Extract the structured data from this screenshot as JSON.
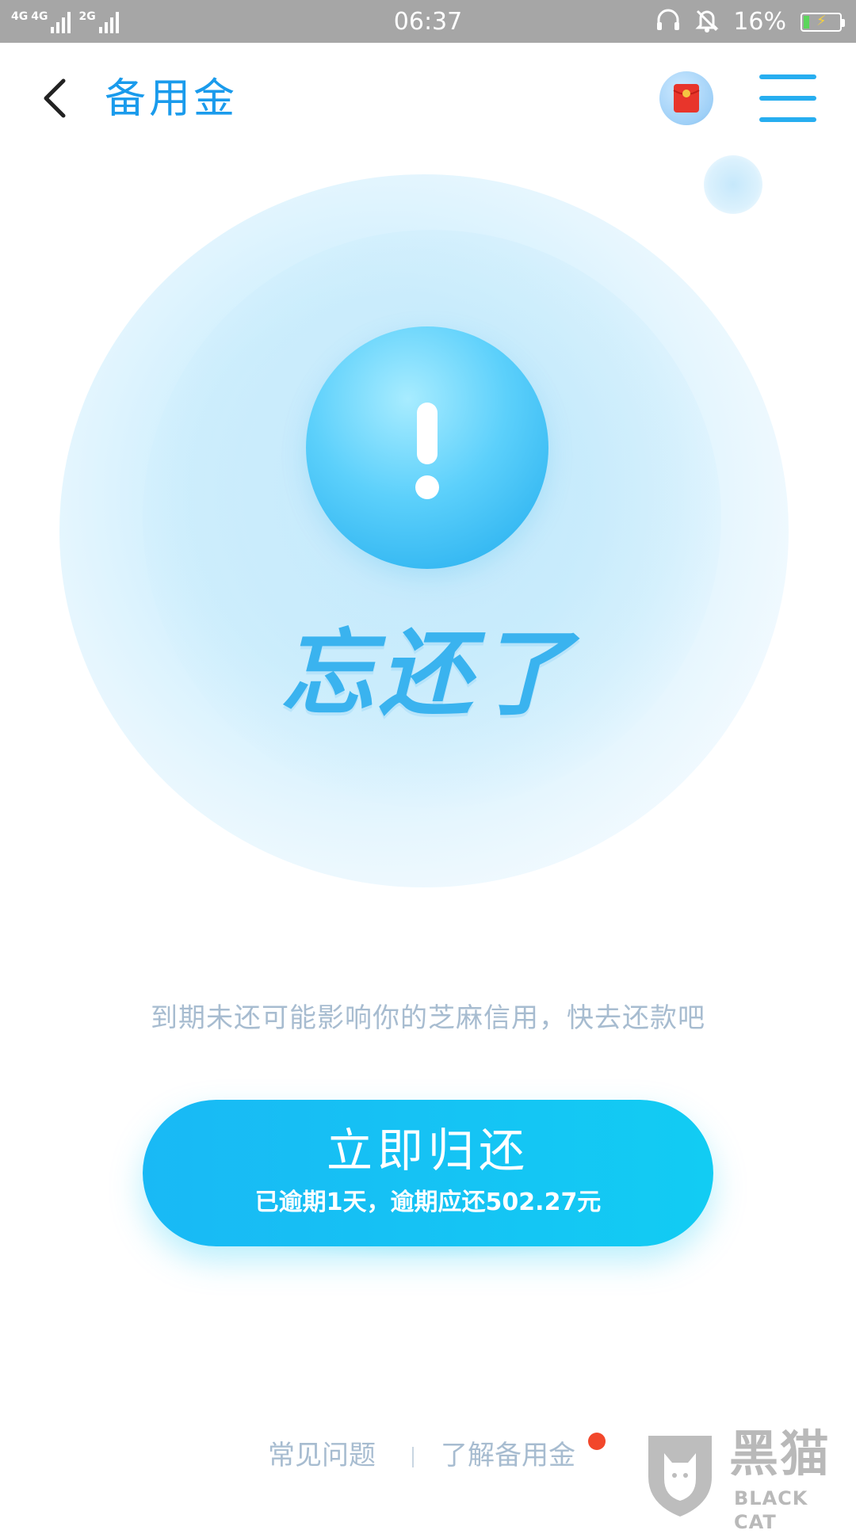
{
  "status_bar": {
    "network_1": "4G",
    "network_2": "4G",
    "network_3": "2G",
    "time": "06:37",
    "battery_percent": "16%",
    "battery_level": 0.16,
    "icons": [
      "headset-icon",
      "bell-muted-icon",
      "battery-icon"
    ]
  },
  "header": {
    "title": "备用金",
    "back_icon": "chevron-left-icon",
    "redpacket_icon": "red-envelope-icon",
    "menu_icon": "hamburger-menu-icon"
  },
  "hero": {
    "headline": "忘还了",
    "alert_icon": "exclamation-icon"
  },
  "notice": "到期未还可能影响你的芝麻信用，快去还款吧",
  "repay_button": {
    "title": "立即归还",
    "subtitle": "已逾期1天，逾期应还502.27元"
  },
  "footer": {
    "faq": "常见问题",
    "separator": "|",
    "about": "了解备用金"
  },
  "watermark": {
    "cn": "黑猫",
    "en": "BLACK CAT"
  },
  "colors": {
    "accent": "#1a9bec",
    "button_start": "#19b9f5",
    "button_end": "#12ccf3",
    "muted_text": "#a7bcd0",
    "badge": "#f2472b"
  }
}
